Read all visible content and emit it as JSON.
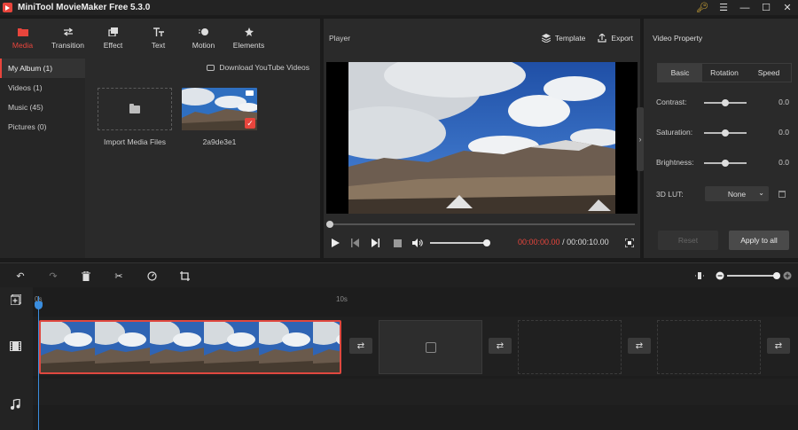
{
  "app": {
    "title": "MiniTool MovieMaker Free 5.3.0"
  },
  "toolbar": {
    "tabs": [
      {
        "label": "Media",
        "icon": "folder-icon"
      },
      {
        "label": "Transition",
        "icon": "transition-icon"
      },
      {
        "label": "Effect",
        "icon": "effect-icon"
      },
      {
        "label": "Text",
        "icon": "text-icon"
      },
      {
        "label": "Motion",
        "icon": "motion-icon"
      },
      {
        "label": "Elements",
        "icon": "elements-icon"
      }
    ]
  },
  "media": {
    "sidebar": [
      {
        "label": "My Album (1)"
      },
      {
        "label": "Videos (1)"
      },
      {
        "label": "Music (45)"
      },
      {
        "label": "Pictures (0)"
      }
    ],
    "download_label": "Download YouTube Videos",
    "import_label": "Import Media Files",
    "clip_name": "2a9de3e1"
  },
  "player": {
    "title": "Player",
    "template_label": "Template",
    "export_label": "Export",
    "current_time": "00:00:00.00",
    "total_time": "/ 00:00:10.00"
  },
  "properties": {
    "title": "Video Property",
    "tabs": [
      "Basic",
      "Rotation",
      "Speed"
    ],
    "contrast_label": "Contrast:",
    "contrast_value": "0.0",
    "saturation_label": "Saturation:",
    "saturation_value": "0.0",
    "brightness_label": "Brightness:",
    "brightness_value": "0.0",
    "lut_label": "3D LUT:",
    "lut_value": "None",
    "reset_label": "Reset",
    "apply_label": "Apply to all"
  },
  "timeline": {
    "ruler_start": "0s",
    "ruler_mark": "10s"
  },
  "colors": {
    "accent": "#e8453c",
    "playhead": "#3a8dde",
    "panel": "#2a2a2a",
    "background": "#1b1b1b"
  }
}
